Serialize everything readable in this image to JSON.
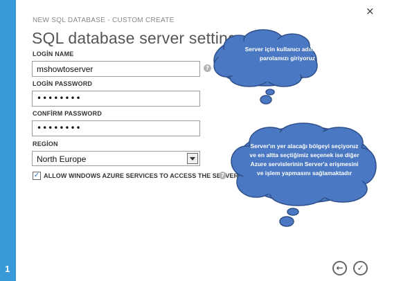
{
  "dialog": {
    "subtitle": "NEW SQL DATABASE - CUSTOM CREATE",
    "title": "SQL database server settings",
    "step_number": "1",
    "close_glyph": "×"
  },
  "form": {
    "login_name_label": "LOGİN NAME",
    "login_name_value": "mshowtoserver",
    "login_password_label": "LOGİN PASSWORD",
    "login_password_value": "••••••••",
    "confirm_password_label": "CONFİRM PASSWORD",
    "confirm_password_value": "••••••••",
    "region_label": "REGİON",
    "region_value": "North Europe",
    "allow_azure_label": "ALLOW WINDOWS AZURE SERVICES TO ACCESS THE SERVER.",
    "allow_azure_checked": true,
    "help_glyph": "?"
  },
  "annotations": {
    "cloud1_text": "Server için kullanıcı  adımızı ve parolamızı  giriyoruz",
    "cloud2_text": "Server'ın yer alacağı bölgeyi seçiyoruz ve en altta seçtiğimiz seçenek ise diğer Azure servislerinin Server'a erişmesini ve işlem yapmasını sağlamaktadır",
    "cloud_color": "#4a78c2",
    "cloud_border_color": "#2e4f8a"
  },
  "navigation": {
    "back_glyph": "←",
    "finish_glyph": "✓"
  },
  "colors": {
    "left_rail": "#3a9ad9"
  },
  "icons": [
    "close-icon",
    "help-icon",
    "chevron-down-icon",
    "checkmark-icon",
    "back-arrow-icon",
    "finish-check-icon"
  ]
}
